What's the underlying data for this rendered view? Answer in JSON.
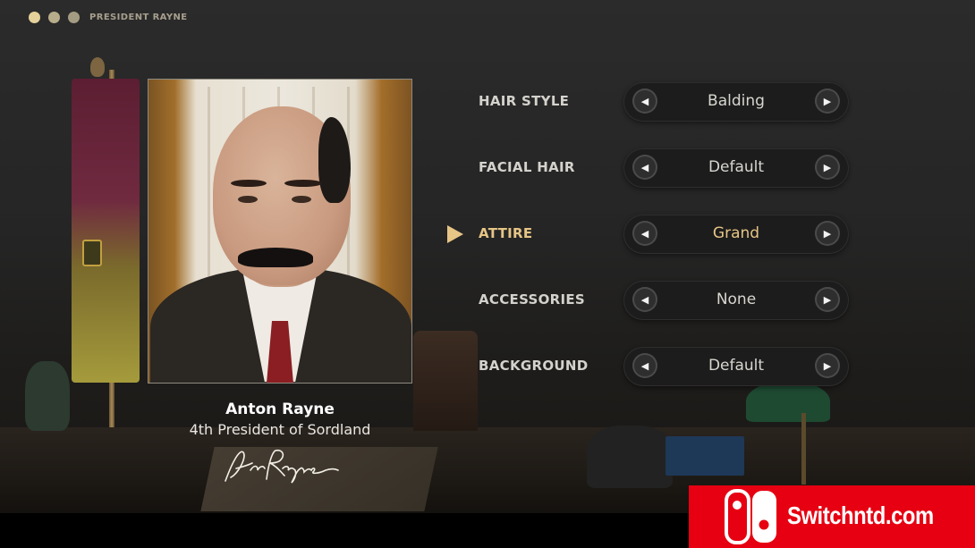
{
  "window": {
    "title": "PRESIDENT RAYNE"
  },
  "portrait": {
    "name": "Anton Rayne",
    "subtitle": "4th President of Sordland",
    "signature_text": "AnRayne"
  },
  "options": [
    {
      "label": "HAIR STYLE",
      "value": "Balding",
      "selected": false
    },
    {
      "label": "FACIAL HAIR",
      "value": "Default",
      "selected": false
    },
    {
      "label": "ATTIRE",
      "value": "Grand",
      "selected": true
    },
    {
      "label": "ACCESSORIES",
      "value": "None",
      "selected": false
    },
    {
      "label": "BACKGROUND",
      "value": "Default",
      "selected": false
    }
  ],
  "controls": {
    "prev_glyph": "◀",
    "next_glyph": "▶",
    "selected_indicator_icon": "triangle-right-icon"
  },
  "watermark": {
    "text": "Switchntd.com",
    "icon": "switch-logo-icon"
  },
  "colors": {
    "accent": "#e6c586",
    "label": "#d4d2cc",
    "watermark_bg": "#e60012"
  }
}
